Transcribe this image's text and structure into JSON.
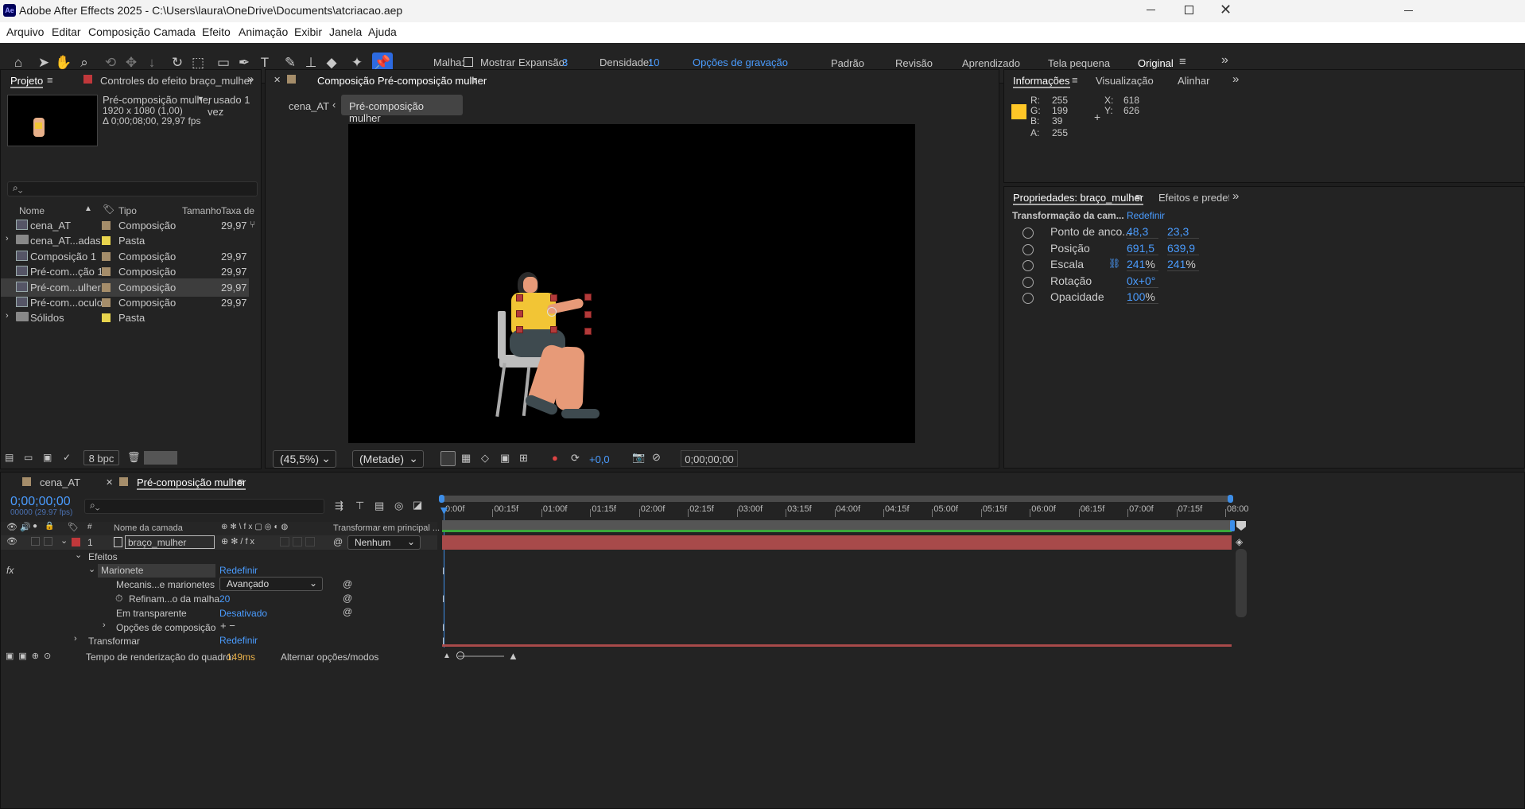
{
  "window": {
    "title": "Adobe After Effects 2025 - C:\\Users\\laura\\OneDrive\\Documents\\atcriacao.aep",
    "app_badge": "Ae"
  },
  "menu": [
    "Arquivo",
    "Editar",
    "Composição",
    "Camada",
    "Efeito",
    "Animação",
    "Exibir",
    "Janela",
    "Ajuda"
  ],
  "toolbar": {
    "mesh_label": "Malha:",
    "show_label": "Mostrar",
    "expansion_label": "Expansão:",
    "expansion_value": "3",
    "density_label": "Densidade:",
    "density_value": "10",
    "record_options": "Opções de gravação",
    "workspaces": [
      "Padrão",
      "Revisão",
      "Aprendizado",
      "Tela pequena",
      "Original"
    ]
  },
  "project": {
    "tab_project": "Projeto",
    "tab_effects": "Controles do efeito braço_mulher",
    "item_name": "Pré-composição mulher",
    "item_usage": ", usado 1 vez",
    "item_dims": "1920 x 1080 (1,00)",
    "item_duration": "Δ 0;00;08;00, 29,97 fps",
    "search_placeholder": "",
    "columns": [
      "Nome",
      "Tipo",
      "Tamanho",
      "Taxa de ..."
    ],
    "items": [
      {
        "name": "cena_AT",
        "type": "Composição",
        "rate": "29,97",
        "kind": "comp",
        "color": "#a58d6a"
      },
      {
        "name": "cena_AT...adas",
        "type": "Pasta",
        "rate": "",
        "kind": "folder",
        "color": "#e8d44d"
      },
      {
        "name": "Composição 1",
        "type": "Composição",
        "rate": "29,97",
        "kind": "comp",
        "color": "#a58d6a"
      },
      {
        "name": "Pré-com...ção 1",
        "type": "Composição",
        "rate": "29,97",
        "kind": "comp",
        "color": "#a58d6a"
      },
      {
        "name": "Pré-com...ulher",
        "type": "Composição",
        "rate": "29,97",
        "kind": "comp",
        "color": "#a58d6a"
      },
      {
        "name": "Pré-com...oculos",
        "type": "Composição",
        "rate": "29,97",
        "kind": "comp",
        "color": "#a58d6a"
      },
      {
        "name": "Sólidos",
        "type": "Pasta",
        "rate": "",
        "kind": "folder",
        "color": "#e8d44d"
      }
    ],
    "bpc": "8 bpc"
  },
  "composition": {
    "tab": "Composição Pré-composição mulher",
    "crumb_parent": "cena_AT",
    "crumb_current": "Pré-composição mulher",
    "zoom": "(45,5%)",
    "resolution": "(Metade)",
    "exposure": "+0,0",
    "timecode": "0;00;00;00"
  },
  "info": {
    "tabs": [
      "Informações",
      "Visualização",
      "Alinhar"
    ],
    "r_label": "R:",
    "r": "255",
    "g_label": "G:",
    "g": "199",
    "b_label": "B:",
    "b": "39",
    "a_label": "A:",
    "a": "255",
    "x_label": "X:",
    "x": "618",
    "y_label": "Y:",
    "y": "626",
    "color": "#ffc727"
  },
  "properties": {
    "tab": "Propriedades: braço_mulher",
    "tab2": "Efeitos e predefini",
    "section": "Transformação da cam...",
    "reset": "Redefinir",
    "rows": [
      {
        "label": "Ponto de anco...",
        "v1": "48,3",
        "v2": "23,3"
      },
      {
        "label": "Posição",
        "v1": "691,5",
        "v2": "639,9"
      },
      {
        "label": "Escala",
        "v1": "241",
        "v1s": "%",
        "v2": "241",
        "v2s": "%"
      },
      {
        "label": "Rotação",
        "v1": "0x+0°",
        "v2": ""
      },
      {
        "label": "Opacidade",
        "v1": "100",
        "v1s": "%",
        "v2": ""
      }
    ]
  },
  "timeline": {
    "tab1": "cena_AT",
    "tab2": "Pré-composição mulher",
    "time": "0;00;00;00",
    "frames": "00000 (29.97 fps)",
    "col_layer": "Nome da camada",
    "col_parent": "Transformar em principal ...",
    "ruler": [
      "0:00f",
      "00:15f",
      "01:00f",
      "01:15f",
      "02:00f",
      "02:15f",
      "03:00f",
      "03:15f",
      "04:00f",
      "04:15f",
      "05:00f",
      "05:15f",
      "06:00f",
      "06:15f",
      "07:00f",
      "07:15f",
      "08:00"
    ],
    "layer": {
      "num": "1",
      "name": "braço_mulher",
      "parent": "Nenhum"
    },
    "effects_label": "Efeitos",
    "puppet": "Marionete",
    "puppet_reset": "Redefinir",
    "engine_label": "Mecanis...e marionetes",
    "engine_value": "Avançado",
    "refine_label": "Refinam...o da malha",
    "refine_value": "20",
    "transparent_label": "Em transparente",
    "transparent_value": "Desativado",
    "comp_options": "Opções de composição",
    "transform": "Transformar",
    "transform_reset": "Redefinir",
    "render_label": "Tempo de renderização do quadro:",
    "render_value": "149ms",
    "toggle": "Alternar opções/modos"
  }
}
